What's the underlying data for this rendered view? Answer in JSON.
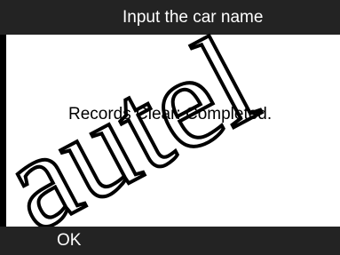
{
  "title_bar": {
    "title": "Input the car name"
  },
  "content": {
    "message": "Records Clear: Completed."
  },
  "soft_keys": {
    "ok_label": "OK"
  },
  "watermark": {
    "text": "autel"
  },
  "colors": {
    "bar_background": "#232323",
    "text_on_bar": "#ffffff",
    "content_background": "#ffffff",
    "message_text": "#000000"
  }
}
